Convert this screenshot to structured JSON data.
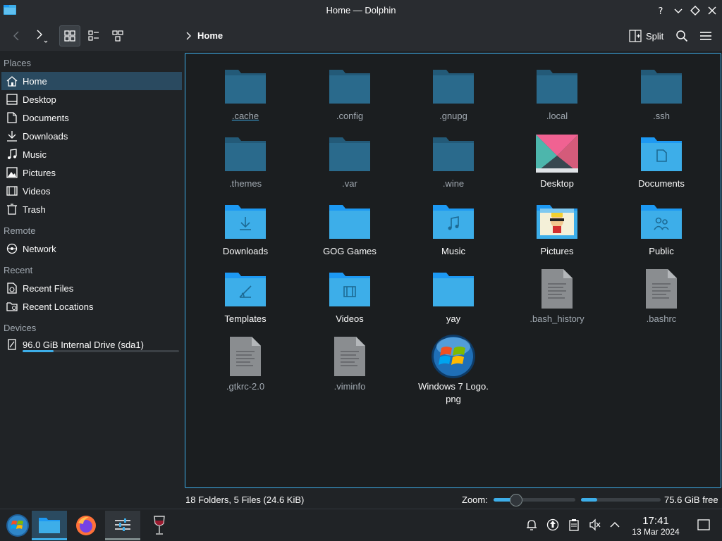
{
  "window": {
    "title": "Home — Dolphin"
  },
  "toolbar": {
    "breadcrumb": "Home",
    "split_label": "Split"
  },
  "sidebar": {
    "sections": {
      "places": "Places",
      "remote": "Remote",
      "recent": "Recent",
      "devices": "Devices"
    },
    "places": [
      {
        "label": "Home",
        "icon": "home-icon"
      },
      {
        "label": "Desktop",
        "icon": "desktop-icon"
      },
      {
        "label": "Documents",
        "icon": "documents-icon"
      },
      {
        "label": "Downloads",
        "icon": "downloads-icon"
      },
      {
        "label": "Music",
        "icon": "music-icon"
      },
      {
        "label": "Pictures",
        "icon": "pictures-icon"
      },
      {
        "label": "Videos",
        "icon": "videos-icon"
      },
      {
        "label": "Trash",
        "icon": "trash-icon"
      }
    ],
    "remote": [
      {
        "label": "Network",
        "icon": "network-icon"
      }
    ],
    "recent": [
      {
        "label": "Recent Files",
        "icon": "recent-files-icon"
      },
      {
        "label": "Recent Locations",
        "icon": "recent-locations-icon"
      }
    ],
    "devices": [
      {
        "label": "96.0 GiB Internal Drive (sda1)",
        "icon": "drive-icon",
        "used_fraction": 0.2
      }
    ]
  },
  "items": [
    {
      "name": ".cache",
      "type": "folder-hidden"
    },
    {
      "name": ".config",
      "type": "folder-hidden"
    },
    {
      "name": ".gnupg",
      "type": "folder-hidden"
    },
    {
      "name": ".local",
      "type": "folder-hidden"
    },
    {
      "name": ".ssh",
      "type": "folder-hidden"
    },
    {
      "name": ".themes",
      "type": "folder-hidden"
    },
    {
      "name": ".var",
      "type": "folder-hidden"
    },
    {
      "name": ".wine",
      "type": "folder-hidden"
    },
    {
      "name": "Desktop",
      "type": "desktop"
    },
    {
      "name": "Documents",
      "type": "folder-documents"
    },
    {
      "name": "Downloads",
      "type": "folder-downloads"
    },
    {
      "name": "GOG Games",
      "type": "folder"
    },
    {
      "name": "Music",
      "type": "folder-music"
    },
    {
      "name": "Pictures",
      "type": "pictures"
    },
    {
      "name": "Public",
      "type": "folder-public"
    },
    {
      "name": "Templates",
      "type": "folder-templates"
    },
    {
      "name": "Videos",
      "type": "folder-videos"
    },
    {
      "name": "yay",
      "type": "folder"
    },
    {
      "name": ".bash_history",
      "type": "file-hidden"
    },
    {
      "name": ".bashrc",
      "type": "file-hidden"
    },
    {
      "name": ".gtkrc-2.0",
      "type": "file-hidden"
    },
    {
      "name": ".viminfo",
      "type": "file-hidden"
    },
    {
      "name": "Windows 7 Logo.\npng",
      "type": "image-win7"
    }
  ],
  "status": {
    "summary": "18 Folders, 5 Files (24.6 KiB)",
    "zoom_label": "Zoom:",
    "zoom_fraction": 0.28,
    "free_text": "75.6 GiB free",
    "free_used_fraction": 0.2
  },
  "taskbar": {
    "apps": [
      "start-menu",
      "dolphin",
      "firefox",
      "settings",
      "wine"
    ],
    "tray": [
      "notifications-icon",
      "updates-icon",
      "clipboard-icon",
      "volume-muted-icon",
      "tray-expand-icon"
    ],
    "time": "17:41",
    "date": "13 Mar 2024"
  },
  "colors": {
    "accent": "#3daee9",
    "folder": "#3daee9",
    "folder_hidden": "#2a6a8c",
    "background": "#1b1e20"
  }
}
